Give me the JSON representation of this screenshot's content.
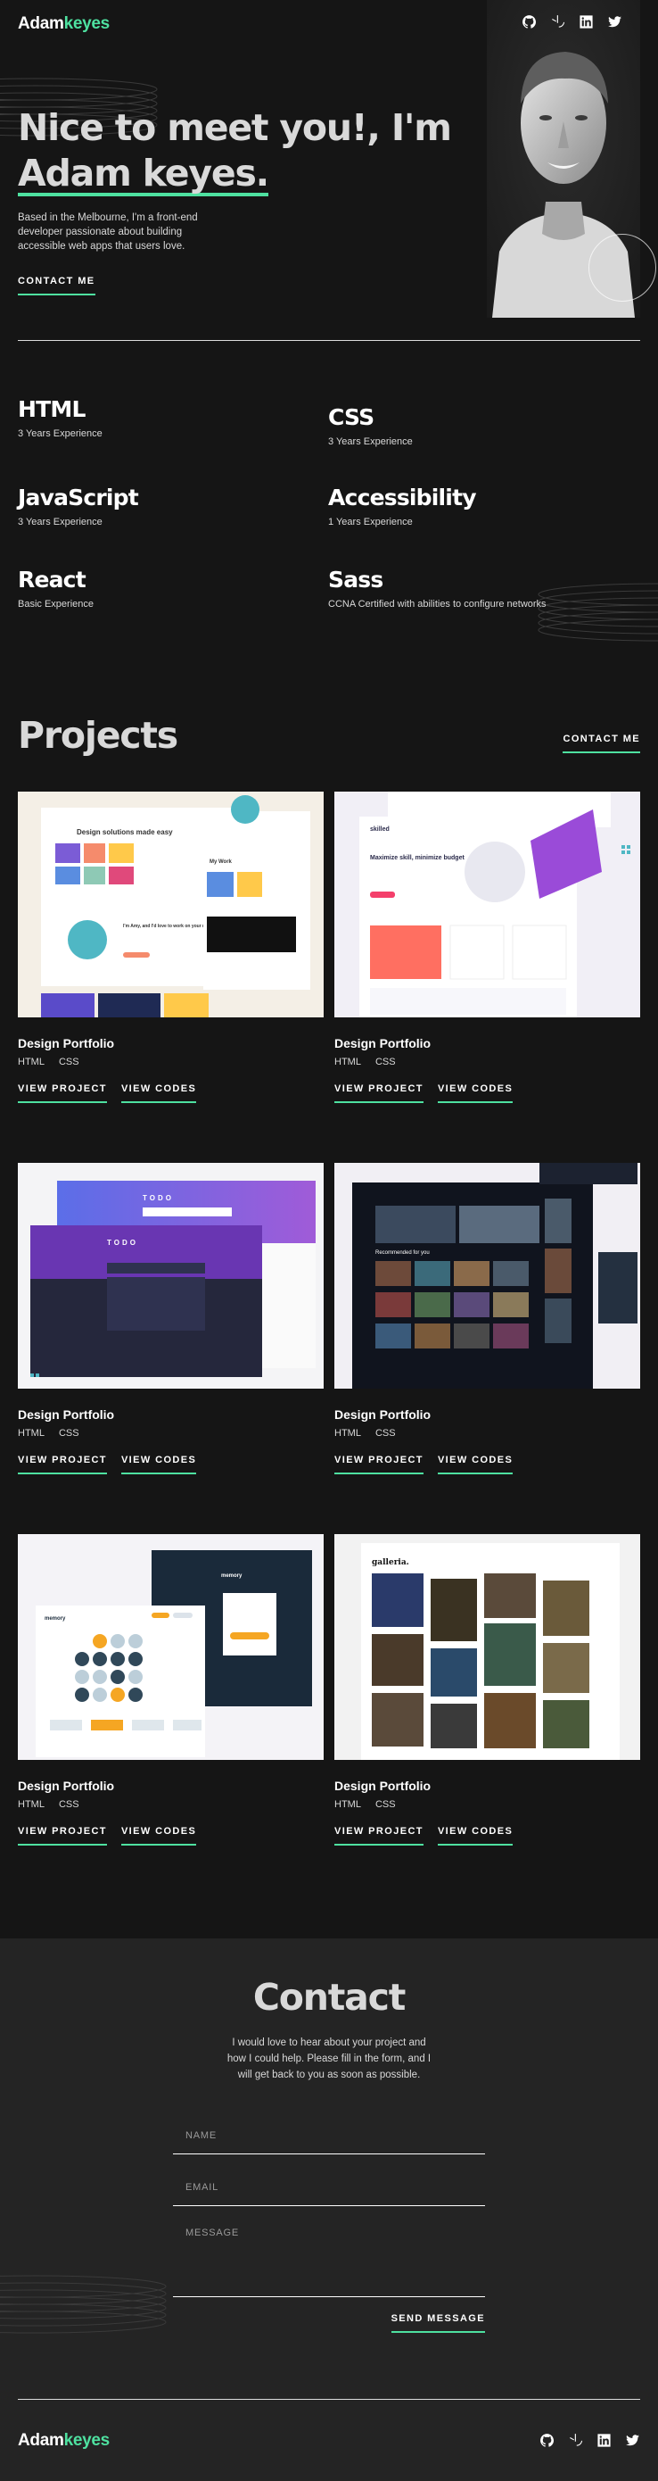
{
  "header": {
    "logo_main": "Adam",
    "logo_accent": "keyes",
    "socials": [
      "github-icon",
      "frontend-mentor-icon",
      "linkedin-icon",
      "twitter-icon"
    ]
  },
  "hero": {
    "title_line1": "Nice to meet you!, I'm",
    "title_name": "Adam keyes.",
    "description": "Based in the Melbourne, I'm a front-end developer passionate about building accessible web apps that users love.",
    "cta": "CONTACT ME"
  },
  "skills": [
    {
      "name": "HTML",
      "experience": "3 Years Experience"
    },
    {
      "name": "CSS",
      "experience": "3 Years Experience"
    },
    {
      "name": "JavaScript",
      "experience": "3 Years Experience"
    },
    {
      "name": "Accessibility",
      "experience": "1 Years Experience"
    },
    {
      "name": "React",
      "experience": "Basic Experience"
    },
    {
      "name": "Sass",
      "experience": "CCNA Certified with abilities to configure networks"
    }
  ],
  "projects_section": {
    "title": "Projects",
    "contact_cta": "CONTACT ME",
    "view_project": "VIEW PROJECT",
    "view_code": "VIEW CODES"
  },
  "projects": [
    {
      "title": "Design Portfolio",
      "tags": [
        "HTML",
        "CSS"
      ],
      "thumb_texts": [
        "Design solutions made easy",
        "I'm Amy, and I'd love to work on your next project",
        "My Work"
      ]
    },
    {
      "title": "Design Portfolio",
      "tags": [
        "HTML",
        "CSS"
      ],
      "thumb_texts": [
        "skilled",
        "Maximize skill, minimize budget"
      ]
    },
    {
      "title": "Design Portfolio",
      "tags": [
        "HTML",
        "CSS"
      ],
      "thumb_texts": [
        "TODO",
        "TODO"
      ]
    },
    {
      "title": "Design Portfolio",
      "tags": [
        "HTML",
        "CSS"
      ],
      "thumb_texts": [
        "Recommended for you"
      ]
    },
    {
      "title": "Design Portfolio",
      "tags": [
        "HTML",
        "CSS"
      ],
      "thumb_texts": [
        "memory",
        "memory"
      ]
    },
    {
      "title": "Design Portfolio",
      "tags": [
        "HTML",
        "CSS"
      ],
      "thumb_texts": [
        "galleria."
      ]
    }
  ],
  "contact": {
    "title": "Contact",
    "description": "I would love to hear about your project and how I could help. Please fill in the form, and I will get back to you as soon as possible.",
    "name_placeholder": "NAME",
    "email_placeholder": "EMAIL",
    "message_placeholder": "MESSAGE",
    "send_label": "SEND MESSAGE"
  },
  "footer": {
    "logo_main": "Adam",
    "logo_accent": "keyes"
  },
  "colors": {
    "accent": "#4ee1a0",
    "background": "#151515",
    "contact_background": "#242424"
  }
}
